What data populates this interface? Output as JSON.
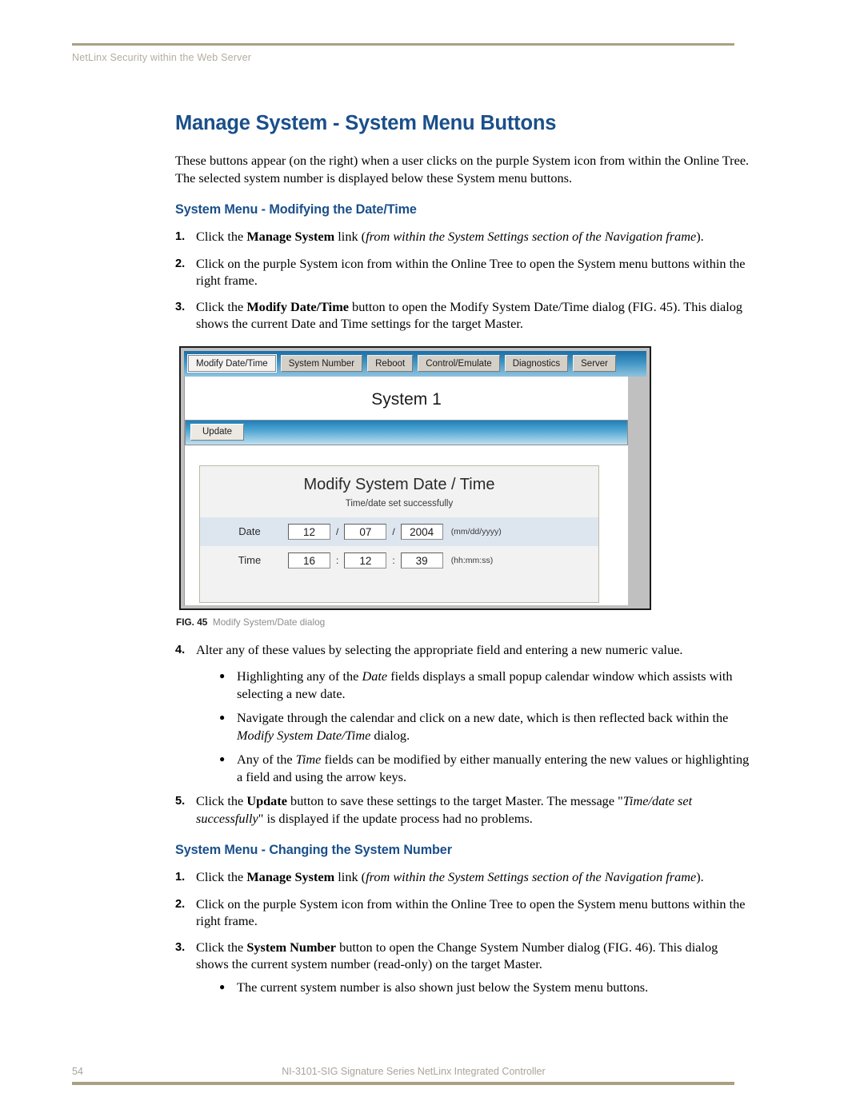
{
  "header": {
    "running_head": "NetLinx Security within the Web Server"
  },
  "title": "Manage System - System Menu Buttons",
  "intro": "These buttons appear (on the right) when a user clicks on the purple System icon from within the Online Tree. The selected system number is displayed below these System menu buttons.",
  "section_datetime": {
    "heading": "System Menu - Modifying the Date/Time",
    "steps": [
      {
        "num": "1.",
        "text_before": "Click the ",
        "bold": "Manage System",
        "text_mid": " link (",
        "italic": "from within the System Settings section of the Navigation frame",
        "text_after": ")."
      },
      {
        "num": "2.",
        "text_before": "Click on the purple System icon from within the Online Tree to open the System menu buttons within the right frame.",
        "bold": "",
        "text_mid": "",
        "italic": "",
        "text_after": ""
      },
      {
        "num": "3.",
        "text_before": "Click the ",
        "bold": "Modify Date/Time",
        "text_mid": " button to open the Modify System Date/Time dialog (FIG. 45). This dialog shows the current Date and Time settings for the target Master.",
        "italic": "",
        "text_after": ""
      }
    ],
    "step4": {
      "num": "4.",
      "text": "Alter any of these values by selecting the appropriate field and entering a new numeric value.",
      "bullets": [
        {
          "before": "Highlighting any of the ",
          "italic": "Date",
          "after": " fields displays a small popup calendar window which assists with selecting a new date."
        },
        {
          "before": "Navigate through the calendar and click on a new date, which is then reflected back within the ",
          "italic": "Modify System Date/Time",
          "after": " dialog."
        },
        {
          "before": "Any of the ",
          "italic": "Time",
          "after": " fields can be modified by either manually entering the new values or highlighting a field and using the arrow keys."
        }
      ]
    },
    "step5": {
      "num": "5.",
      "before": "Click the ",
      "bold": "Update",
      "mid": " button to save these settings to the target Master. The message \"",
      "italic": "Time/date set successfully",
      "after": "\" is displayed if the update process had no problems."
    }
  },
  "figure": {
    "caption_label": "FIG. 45",
    "caption_text": "Modify System/Date dialog",
    "tabs": [
      {
        "label": "Modify Date/Time",
        "active": true
      },
      {
        "label": "System Number",
        "active": false
      },
      {
        "label": "Reboot",
        "active": false
      },
      {
        "label": "Control/Emulate",
        "active": false
      },
      {
        "label": "Diagnostics",
        "active": false
      },
      {
        "label": "Server",
        "active": false
      }
    ],
    "system_title": "System 1",
    "update_button": "Update",
    "dialog": {
      "title": "Modify System Date / Time",
      "message": "Time/date set successfully",
      "date_label": "Date",
      "date_month": "12",
      "date_day": "07",
      "date_year": "2004",
      "date_sep1": "/",
      "date_sep2": "/",
      "date_hint": "(mm/dd/yyyy)",
      "time_label": "Time",
      "time_hours": "16",
      "time_minutes": "12",
      "time_seconds": "39",
      "time_sep1": ":",
      "time_sep2": ":",
      "time_hint": "(hh:mm:ss)"
    }
  },
  "section_sysnum": {
    "heading": "System Menu - Changing the System Number",
    "steps": [
      {
        "num": "1.",
        "text_before": "Click the ",
        "bold": "Manage System",
        "text_mid": " link (",
        "italic": "from within the System Settings section of the Navigation frame",
        "text_after": ")."
      },
      {
        "num": "2.",
        "text_before": "Click on the purple System icon from within the Online Tree to open the System menu buttons within the right frame.",
        "bold": "",
        "text_mid": "",
        "italic": "",
        "text_after": ""
      },
      {
        "num": "3.",
        "text_before": "Click the ",
        "bold": "System Number",
        "text_mid": " button to open the Change System Number dialog (FIG. 46). This dialog shows the current system number (read-only) on the target Master.",
        "italic": "",
        "text_after": ""
      }
    ],
    "bullet": "The current system number is also shown just below the System menu buttons."
  },
  "footer": {
    "page_number": "54",
    "document_title": "NI-3101-SIG Signature Series NetLinx Integrated Controller"
  },
  "colors": {
    "accent_blue": "#1a4f8a",
    "rule_olive": "#a9a083",
    "header_gray": "#b3ada0"
  }
}
